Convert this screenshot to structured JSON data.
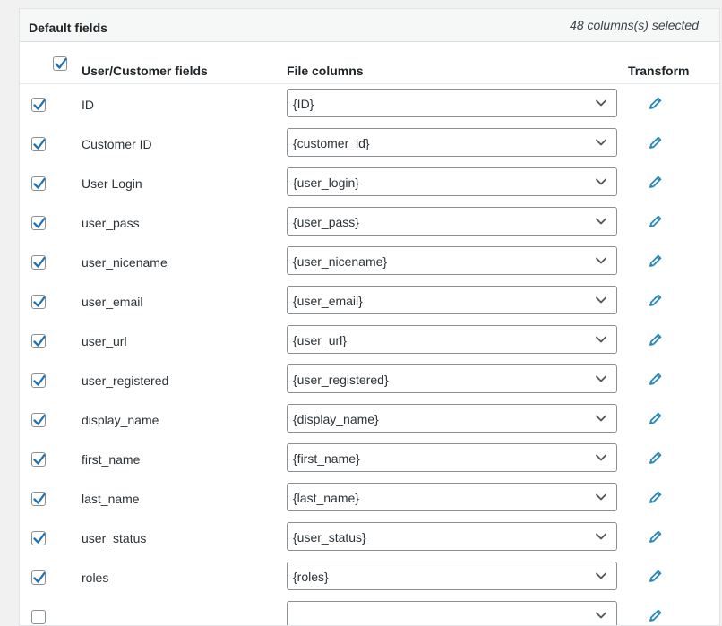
{
  "panel": {
    "title": "Default fields",
    "selected_count": "48 columns(s) selected"
  },
  "table": {
    "headers": {
      "fields": "User/Customer fields",
      "columns": "File columns",
      "transform": "Transform"
    },
    "select_all_checked": true,
    "rows": [
      {
        "label": "ID",
        "value": "{ID}",
        "checked": true
      },
      {
        "label": "Customer ID",
        "value": "{customer_id}",
        "checked": true
      },
      {
        "label": "User Login",
        "value": "{user_login}",
        "checked": true
      },
      {
        "label": "user_pass",
        "value": "{user_pass}",
        "checked": true
      },
      {
        "label": "user_nicename",
        "value": "{user_nicename}",
        "checked": true
      },
      {
        "label": "user_email",
        "value": "{user_email}",
        "checked": true
      },
      {
        "label": "user_url",
        "value": "{user_url}",
        "checked": true
      },
      {
        "label": "user_registered",
        "value": "{user_registered}",
        "checked": true
      },
      {
        "label": "display_name",
        "value": "{display_name}",
        "checked": true
      },
      {
        "label": "first_name",
        "value": "{first_name}",
        "checked": true
      },
      {
        "label": "last_name",
        "value": "{last_name}",
        "checked": true
      },
      {
        "label": "user_status",
        "value": "{user_status}",
        "checked": true
      },
      {
        "label": "roles",
        "value": "{roles}",
        "checked": true
      },
      {
        "label": "",
        "value": "",
        "checked": false
      }
    ]
  },
  "icons": {
    "checkmark": "checkmark-icon",
    "dropdown": "chevron-down-icon",
    "transform": "pencil-icon"
  },
  "colors": {
    "accent": "#2271b1",
    "pencil": "#2a8bb8",
    "header_bg": "#f6f7f7",
    "page_bg": "#f1f1f1"
  }
}
